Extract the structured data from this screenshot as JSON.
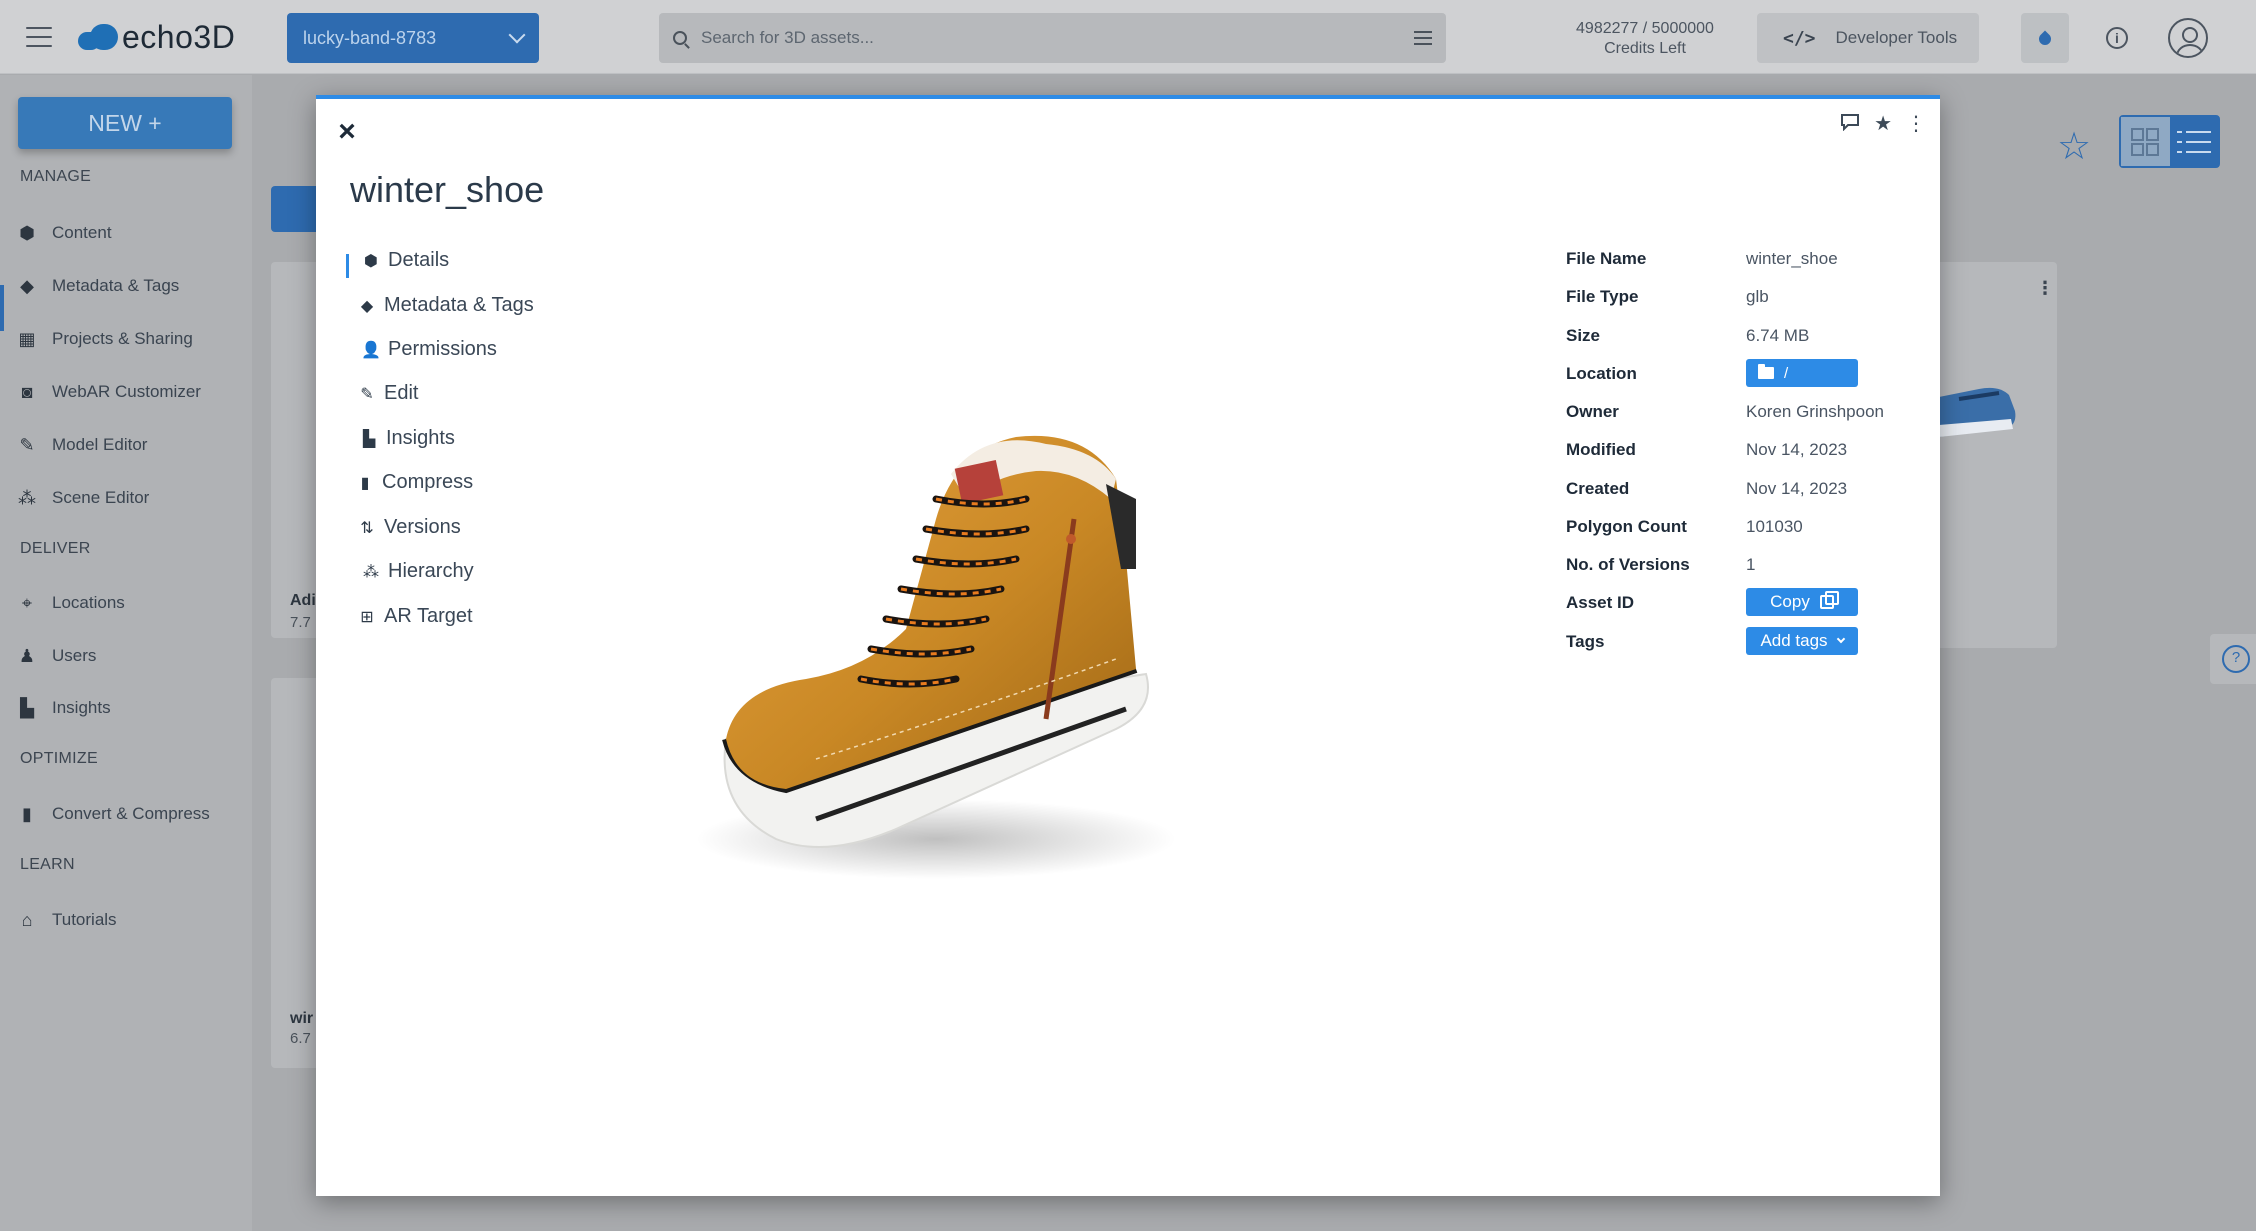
{
  "topbar": {
    "logo_text": "echo3D",
    "project": "lucky-band-8783",
    "search_placeholder": "Search for 3D assets...",
    "credits_value": "4982277 / 5000000",
    "credits_label": "Credits Left",
    "devtools_label": "Developer Tools",
    "devtools_icon": "</>",
    "info_icon": "i"
  },
  "sidebar": {
    "new_label": "NEW +",
    "sections": {
      "manage": "MANAGE",
      "deliver": "DELIVER",
      "optimize": "OPTIMIZE",
      "learn": "LEARN"
    },
    "items": [
      {
        "label": "Content",
        "icon": "cube-icon"
      },
      {
        "label": "Metadata & Tags",
        "icon": "tag-icon"
      },
      {
        "label": "Projects & Sharing",
        "icon": "table-icon"
      },
      {
        "label": "WebAR Customizer",
        "icon": "vr-goggles-icon"
      },
      {
        "label": "Model Editor",
        "icon": "pencil-icon"
      },
      {
        "label": "Scene Editor",
        "icon": "cubes-icon"
      },
      {
        "label": "Locations",
        "icon": "crosshair-icon"
      },
      {
        "label": "Users",
        "icon": "person-icon"
      },
      {
        "label": "Insights",
        "icon": "chart-icon"
      },
      {
        "label": "Convert & Compress",
        "icon": "file-zip-icon"
      },
      {
        "label": "Tutorials",
        "icon": "school-icon"
      }
    ]
  },
  "background_cards": {
    "card1_title": "Adi",
    "card1_sub": "7.7",
    "card2_title": "wir",
    "card2_sub": "6.7"
  },
  "modal": {
    "title": "winter_shoe",
    "close_icon": "×",
    "tabs": [
      {
        "label": "Details",
        "icon": "cube-icon"
      },
      {
        "label": "Metadata & Tags",
        "icon": "tag-icon"
      },
      {
        "label": "Permissions",
        "icon": "user-plus-icon"
      },
      {
        "label": "Edit",
        "icon": "pencil-icon"
      },
      {
        "label": "Insights",
        "icon": "chart-icon"
      },
      {
        "label": "Compress",
        "icon": "file-zip-icon"
      },
      {
        "label": "Versions",
        "icon": "arrows-cycle-icon"
      },
      {
        "label": "Hierarchy",
        "icon": "sitemap-icon"
      },
      {
        "label": "AR Target",
        "icon": "grid-icon"
      }
    ],
    "details": {
      "file_name_label": "File Name",
      "file_name": "winter_shoe",
      "file_type_label": "File Type",
      "file_type": "glb",
      "size_label": "Size",
      "size": "6.74 MB",
      "location_label": "Location",
      "location": "/",
      "owner_label": "Owner",
      "owner": "Koren Grinshpoon",
      "modified_label": "Modified",
      "modified": "Nov 14, 2023",
      "created_label": "Created",
      "created": "Nov 14, 2023",
      "polygon_label": "Polygon Count",
      "polygon_count": "101030",
      "versions_label": "No. of Versions",
      "versions": "1",
      "asset_id_label": "Asset ID",
      "copy_label": "Copy",
      "tags_label": "Tags",
      "add_tags_label": "Add tags"
    }
  },
  "colors": {
    "accent": "#2d8be6",
    "brand": "#1f6fb5",
    "overlay_bg": "#a9abae"
  }
}
